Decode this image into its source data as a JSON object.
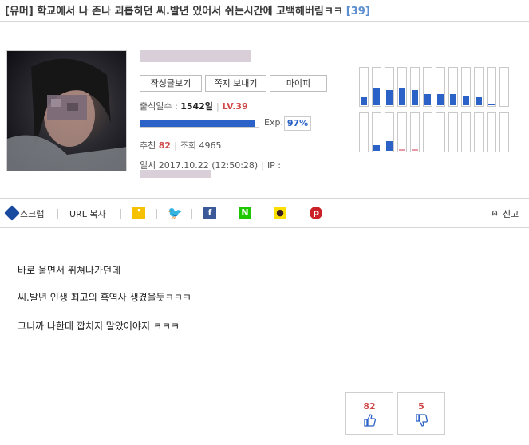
{
  "post": {
    "title": "[유머] 학교에서 나 존나 괴롭히던 씨.발년 있어서 쉬는시간에 고백해버림ㅋㅋ",
    "comment_count": "[39]"
  },
  "profile": {
    "buttons": [
      "작성글보기",
      "쪽지 보내기",
      "마이피"
    ],
    "attendance_label": "출석일수 :",
    "attendance_value": "1542일",
    "level": "LV.39",
    "exp_label": "Exp.",
    "exp_percent": "97%",
    "exp_fraction": 0.97,
    "recommend_label": "추천",
    "recommend_value": "82",
    "views_label": "조회",
    "views_value": "4965",
    "date_label": "일시",
    "date_value": "2017.10.22 (12:50:28)",
    "ip_label": "IP :"
  },
  "activity_bars": {
    "top_row": [
      0.2,
      0.45,
      0.4,
      0.45,
      0.4,
      0.3,
      0.3,
      0.3,
      0.25,
      0.2,
      0.05,
      0
    ],
    "bottom_row": [
      0,
      0.15,
      0.25,
      0.05,
      0.05,
      0,
      0,
      0,
      0,
      0,
      0,
      0
    ],
    "bottom_colors": [
      "blue",
      "blue",
      "blue",
      "pink",
      "pink",
      "blue",
      "blue",
      "blue",
      "blue",
      "blue",
      "blue",
      "blue"
    ],
    "accent": "#2a62c7"
  },
  "toolbar": {
    "scrap": "스크랩",
    "url_copy": "URL 복사",
    "report": "신고"
  },
  "content": {
    "lines": [
      "바로 울면서 뛰쳐나가던데",
      "씨.발년 인생 최고의 흑역사 생겼을듯ㅋㅋㅋ",
      "그니까 나한테 깝치지 말았어야지 ㅋㅋㅋ"
    ]
  },
  "votes": {
    "up": "82",
    "down": "5"
  }
}
